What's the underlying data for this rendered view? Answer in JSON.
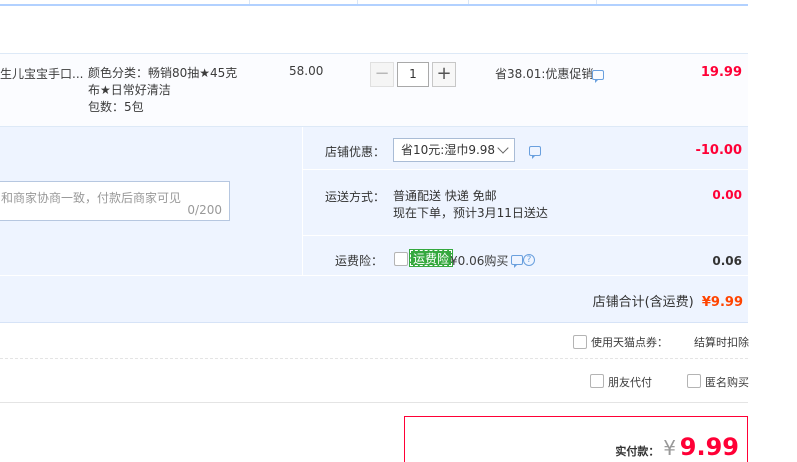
{
  "item": {
    "title": "生儿宝宝手口...",
    "sku_line1": "颜色分类：畅销80抽★45克布★日常好清洁",
    "sku_line2": "包数：5包",
    "price": "58.00",
    "qty_minus": "−",
    "quantity": "1",
    "qty_plus": "+",
    "promo": "省38.01:优惠促销",
    "total": "19.99"
  },
  "shop": {
    "coupon_label": "店铺优惠：",
    "coupon_value": "省10元:湿巾9.98",
    "coupon_amount": "-10.00",
    "message_placeholder": "和商家协商一致，付款后商家可见",
    "message_count": "0/200",
    "shipping_label": "运送方式：",
    "shipping_line1": "普通配送 快递 免邮",
    "shipping_line2": "现在下单，预计3月11日送达",
    "shipping_amount": "0.00",
    "insurance_label": "运费险：",
    "insurance_tag": "运费险",
    "insurance_price": "¥0.06购买",
    "insurance_amount": "0.06",
    "help_glyph": "?",
    "subtotal_label": "店铺合计(含运费)",
    "subtotal_value": "¥9.99"
  },
  "options": {
    "tmall_points_label": "使用天猫点券：",
    "tmall_points_note": "结算时扣除",
    "friend_pay_label": "朋友代付",
    "anonymous_label": "匿名购买"
  },
  "payment": {
    "label": "实付款：",
    "currency": "¥",
    "amount": "9.99"
  },
  "colors": {
    "accent_red": "#ff0036",
    "orange": "#ff4400",
    "insurance_green": "#35a83f"
  },
  "icons": [
    "chat-icon",
    "chevron-down-icon",
    "help-icon"
  ]
}
